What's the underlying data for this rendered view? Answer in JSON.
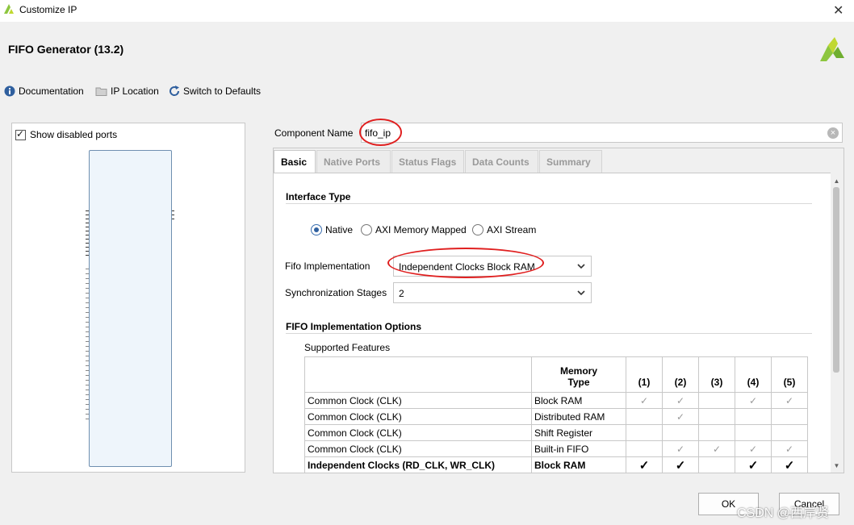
{
  "window": {
    "title": "Customize IP",
    "close_glyph": "✕"
  },
  "header": {
    "title": "FIFO Generator (13.2)"
  },
  "toolbar": {
    "documentation": "Documentation",
    "ip_location": "IP Location",
    "switch_defaults": "Switch to Defaults"
  },
  "left_panel": {
    "show_disabled_ports_label": "Show disabled ports",
    "show_disabled_ports_checked": true
  },
  "component": {
    "label": "Component Name",
    "value": "fifo_ip"
  },
  "tabs": [
    {
      "label": "Basic",
      "active": true
    },
    {
      "label": "Native Ports",
      "active": false
    },
    {
      "label": "Status Flags",
      "active": false
    },
    {
      "label": "Data Counts",
      "active": false
    },
    {
      "label": "Summary",
      "active": false
    }
  ],
  "basic": {
    "interface_type_title": "Interface Type",
    "interface_options": [
      {
        "label": "Native",
        "selected": true
      },
      {
        "label": "AXI Memory Mapped",
        "selected": false
      },
      {
        "label": "AXI Stream",
        "selected": false
      }
    ],
    "fifo_impl_label": "Fifo Implementation",
    "fifo_impl_value": "Independent Clocks Block RAM",
    "sync_stages_label": "Synchronization Stages",
    "sync_stages_value": "2",
    "impl_options_title": "FIFO Implementation Options",
    "supported_features_label": "Supported Features"
  },
  "feature_table": {
    "header_memory_type": [
      "Memory",
      "Type"
    ],
    "columns": [
      "(1)",
      "(2)",
      "(3)",
      "(4)",
      "(5)"
    ],
    "rows": [
      {
        "feature": "Common Clock (CLK)",
        "memory": "Block RAM",
        "marks": [
          "✓",
          "✓",
          "",
          "✓",
          "✓"
        ],
        "bold": false
      },
      {
        "feature": "Common Clock (CLK)",
        "memory": "Distributed RAM",
        "marks": [
          "",
          "✓",
          "",
          "",
          ""
        ],
        "bold": false
      },
      {
        "feature": "Common Clock (CLK)",
        "memory": "Shift Register",
        "marks": [
          "",
          "",
          "",
          "",
          ""
        ],
        "bold": false
      },
      {
        "feature": "Common Clock (CLK)",
        "memory": "Built-in FIFO",
        "marks": [
          "",
          "✓",
          "✓",
          "✓",
          "✓"
        ],
        "bold": false
      },
      {
        "feature": "Independent Clocks (RD_CLK, WR_CLK)",
        "memory": "Block RAM",
        "marks": [
          "✓",
          "✓",
          "",
          "✓",
          "✓"
        ],
        "bold": true
      }
    ]
  },
  "buttons": {
    "ok": "OK",
    "cancel": "Cancel"
  },
  "watermark": "CSDN @西岸贤",
  "colors": {
    "accent": "#2f5f9e",
    "annotation": "#e02020",
    "logo_green": "#8dc63f"
  }
}
